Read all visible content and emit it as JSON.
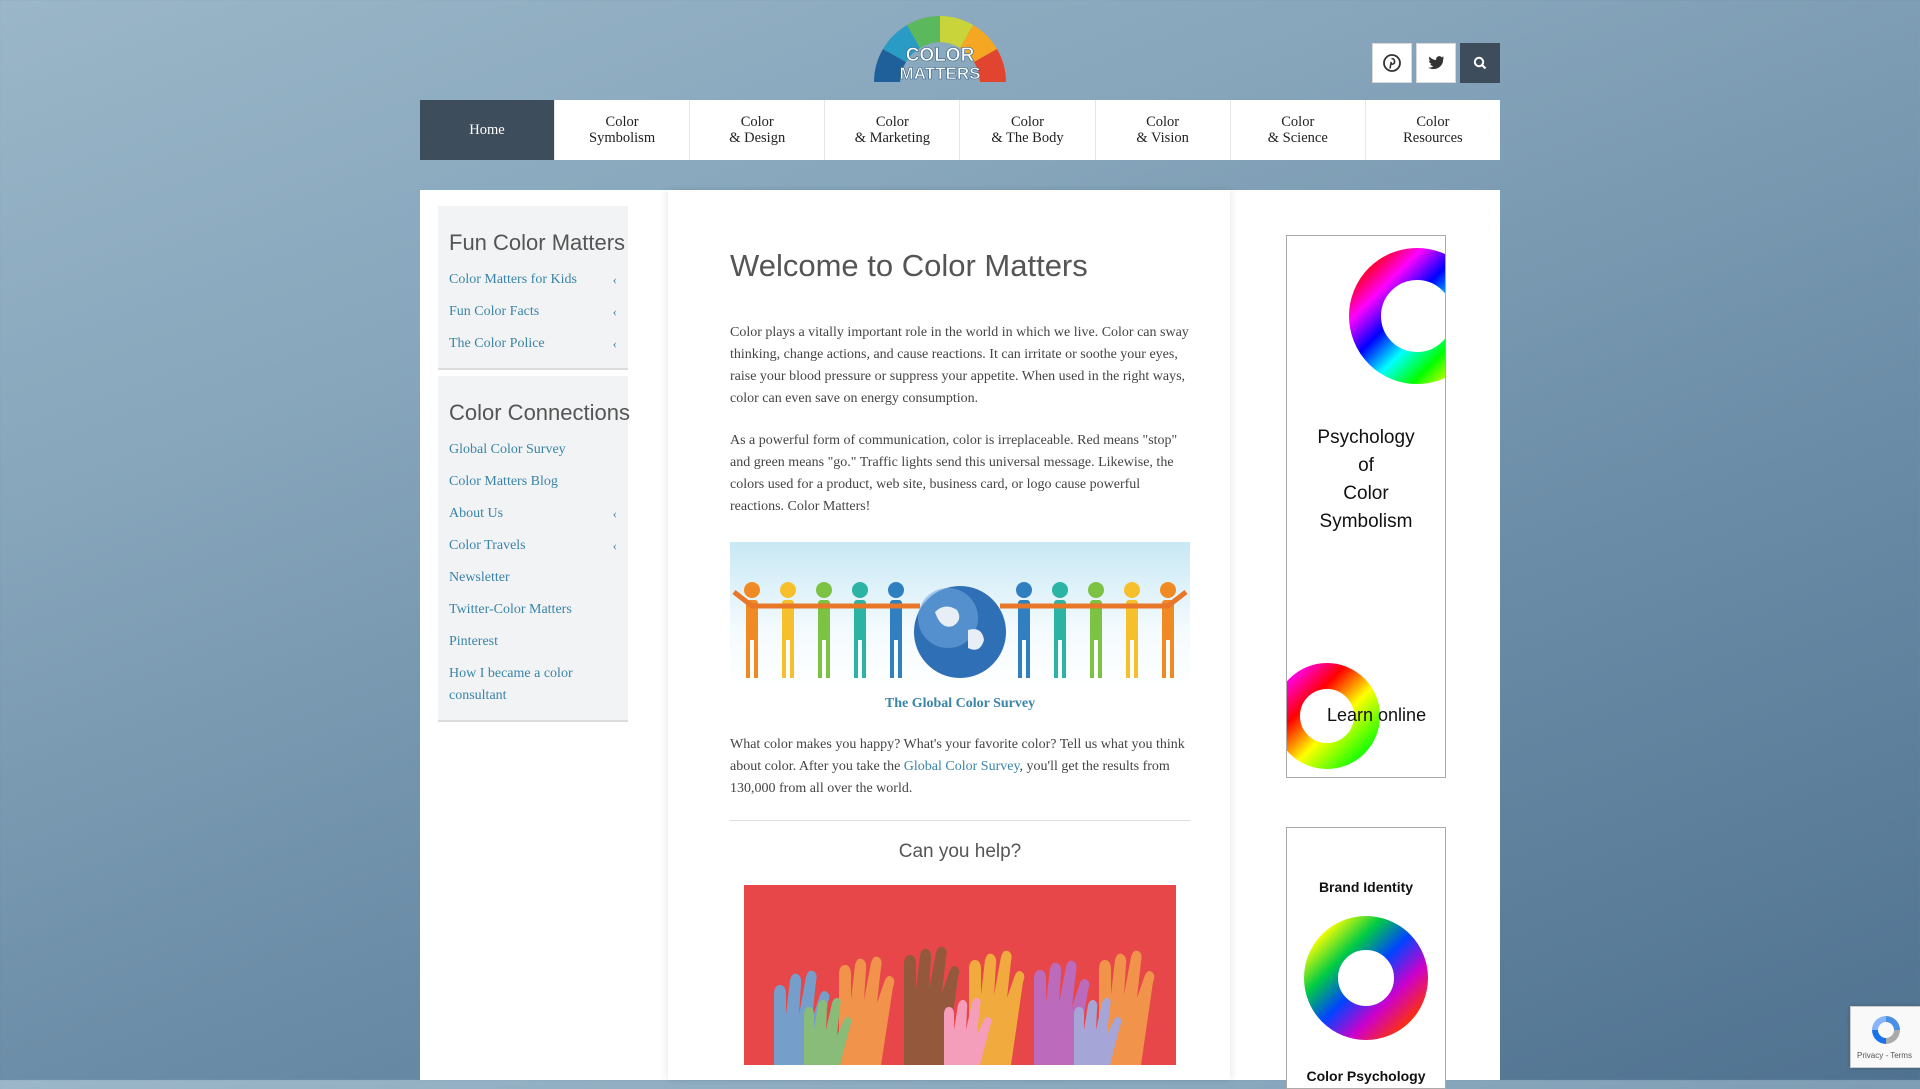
{
  "logo": {
    "line1": "COLOR",
    "line2": "MATTERS"
  },
  "social": {
    "pinterest": "pinterest-icon",
    "twitter": "twitter-icon",
    "search": "search-icon"
  },
  "nav": [
    {
      "label": "Home"
    },
    {
      "label": "Color\nSymbolism"
    },
    {
      "label": "Color\n& Design"
    },
    {
      "label": "Color\n& Marketing"
    },
    {
      "label": "Color\n& The Body"
    },
    {
      "label": "Color\n& Vision"
    },
    {
      "label": "Color\n& Science"
    },
    {
      "label": "Color\nResources"
    }
  ],
  "sidebar": {
    "fun": {
      "title": "Fun Color Matters",
      "items": [
        "Color Matters for Kids",
        "Fun Color Facts",
        "The Color Police"
      ]
    },
    "connections": {
      "title": "Color Connections",
      "items": [
        "Global Color Survey",
        "Color Matters Blog",
        "About Us",
        "Color Travels",
        "Newsletter",
        "Twitter-Color Matters",
        "Pinterest",
        "How I became a color consultant"
      ]
    }
  },
  "main": {
    "title": "Welcome to Color Matters",
    "p1": "Color plays a vitally important role in the world in which we live. Color can sway thinking, change actions, and cause reactions. It can irritate or soothe your eyes, raise your blood pressure or suppress your appetite. When used in the right ways, color can even save on energy consumption.",
    "p2": "As a powerful form of communication, color is irreplaceable. Red means \"stop\" and green means \"go.\" Traffic lights send this universal message. Likewise, the colors used for a product, web site, business card, or logo cause powerful reactions. Color Matters!",
    "caption": "The Global Color Survey",
    "p3_start": "What color makes you happy? What's your favorite color? Tell us what you think about color. After you take the ",
    "p3_link": "Global Color Survey",
    "p3_end": ", you'll get the results from 130,000 from all over the world.",
    "help": "Can you help?"
  },
  "ads": {
    "ad1_title": "Psychology\nof\nColor\nSymbolism",
    "ad1_cta": "Learn online",
    "ad2_title": "Brand Identity",
    "ad2_sub": "Color Psychology"
  },
  "recaptcha": {
    "text": "Privacy - Terms"
  },
  "colors": {
    "accent": "#3a84a8",
    "nav_active": "#3e4d5c"
  }
}
